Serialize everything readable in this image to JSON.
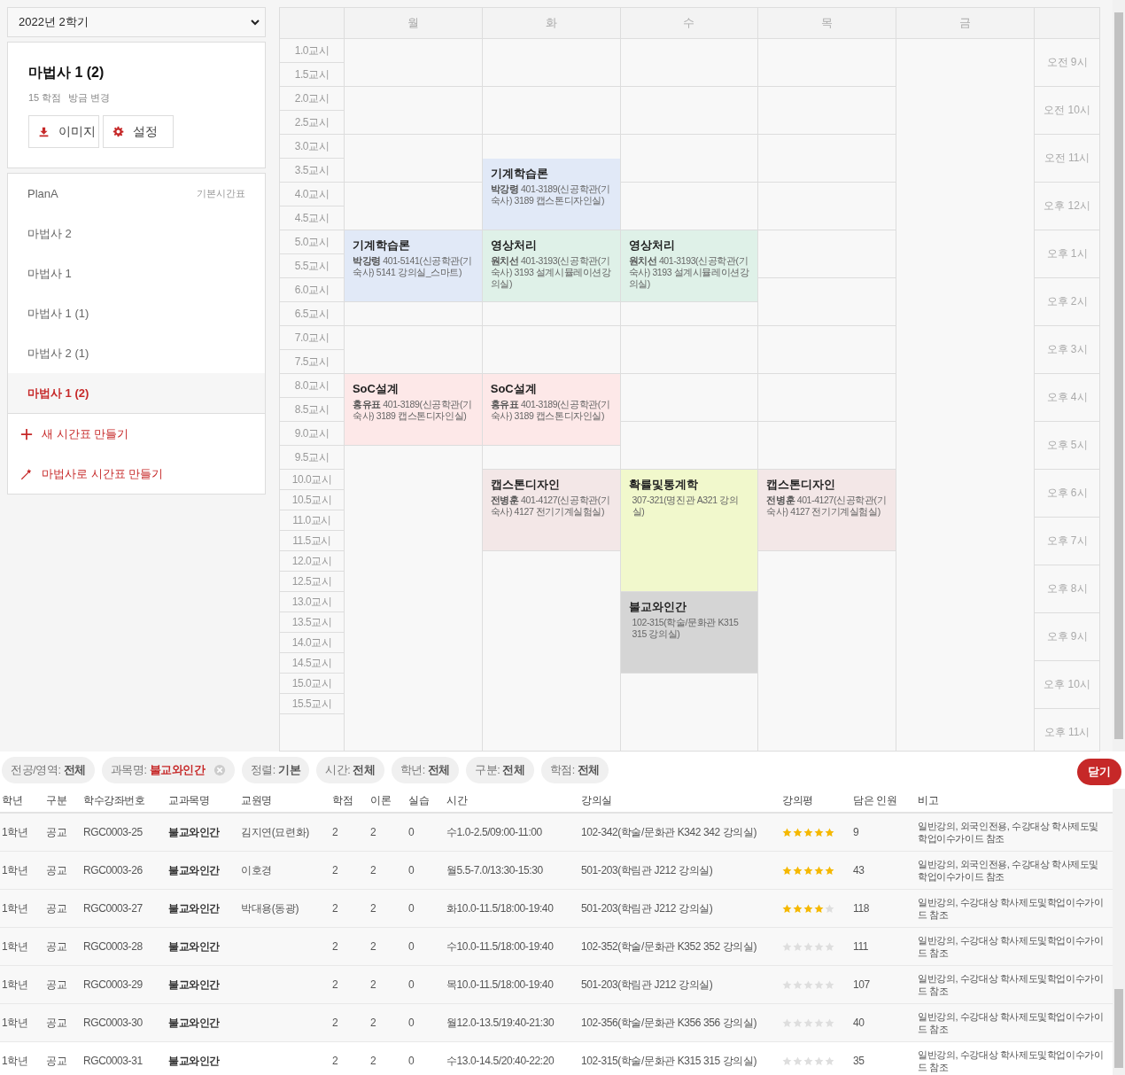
{
  "semester_select": {
    "value": "2022년 2학기"
  },
  "timetable_card": {
    "title": "마법사 1 (2)",
    "credits": "15 학점",
    "modified": "방금 변경",
    "buttons": [
      {
        "kind": "download",
        "label": "이미지"
      },
      {
        "kind": "settings",
        "label": "설정"
      }
    ]
  },
  "timetable_list": [
    {
      "label": "PlanA",
      "badge": "기본시간표",
      "selected": false
    },
    {
      "label": "마법사 2",
      "selected": false
    },
    {
      "label": "마법사 1",
      "selected": false
    },
    {
      "label": "마법사 1 (1)",
      "selected": false
    },
    {
      "label": "마법사 2 (1)",
      "selected": false
    },
    {
      "label": "마법사 1 (2)",
      "selected": true
    }
  ],
  "list_actions": [
    {
      "kind": "add",
      "label": "새 시간표 만들기"
    },
    {
      "kind": "wizard",
      "label": "마법사로 시간표 만들기"
    }
  ],
  "schedule": {
    "periods": [
      "1.0교시",
      "1.5교시",
      "2.0교시",
      "2.5교시",
      "3.0교시",
      "3.5교시",
      "4.0교시",
      "4.5교시",
      "5.0교시",
      "5.5교시",
      "6.0교시",
      "6.5교시",
      "7.0교시",
      "7.5교시",
      "8.0교시",
      "8.5교시",
      "9.0교시",
      "9.5교시",
      "10.0교시",
      "10.5교시",
      "11.0교시",
      "11.5교시",
      "12.0교시",
      "12.5교시",
      "13.0교시",
      "13.5교시",
      "14.0교시",
      "14.5교시",
      "15.0교시",
      "15.5교시"
    ],
    "days": [
      {
        "label": "월",
        "slots": [
          {
            "kind": "free"
          },
          {
            "kind": "free"
          },
          {
            "kind": "free"
          },
          {
            "kind": "free"
          },
          {
            "kind": "free"
          },
          {
            "kind": "free"
          },
          {
            "kind": "free"
          },
          {
            "kind": "free"
          },
          {
            "kind": "course",
            "title": "기계학습론",
            "professor": "박강령",
            "room": "401-5141(신공학관(기숙사) 5141 강의실_스마트)",
            "color": "#e1e9f7"
          },
          {
            "kind": "cont"
          },
          {
            "kind": "cont"
          },
          {
            "kind": "free"
          },
          {
            "kind": "free"
          },
          {
            "kind": "free"
          },
          {
            "kind": "course",
            "title": "SoC설계",
            "professor": "홍유표",
            "room": "401-3189(신공학관(기숙사) 3189 캡스톤디자인실)",
            "color": "#fde8e8"
          },
          {
            "kind": "cont"
          },
          {
            "kind": "cont"
          }
        ]
      },
      {
        "label": "화",
        "slots": [
          {
            "kind": "free"
          },
          {
            "kind": "free"
          },
          {
            "kind": "free"
          },
          {
            "kind": "free"
          },
          {
            "kind": "free"
          },
          {
            "kind": "course",
            "title": "기계학습론",
            "professor": "박강령",
            "room": "401-3189(신공학관(기숙사) 3189 캡스톤디자인실)",
            "color": "#e1e9f7"
          },
          {
            "kind": "cont"
          },
          {
            "kind": "cont"
          },
          {
            "kind": "course",
            "title": "영상처리",
            "professor": "원치선",
            "room": "401-3193(신공학관(기숙사) 3193 설계시뮬레이션강의실)",
            "color": "#dff1e8"
          },
          {
            "kind": "cont"
          },
          {
            "kind": "cont"
          },
          {
            "kind": "free"
          },
          {
            "kind": "free"
          },
          {
            "kind": "free"
          },
          {
            "kind": "course",
            "title": "SoC설계",
            "professor": "홍유표",
            "room": "401-3189(신공학관(기숙사) 3189 캡스톤디자인실)",
            "color": "#fde8e8"
          },
          {
            "kind": "cont"
          },
          {
            "kind": "cont"
          },
          {
            "kind": "free"
          },
          {
            "kind": "course",
            "title": "캡스톤디자인",
            "professor": "전병훈",
            "room": "401-4127(신공학관(기숙사) 4127 전기기계실험실)",
            "color": "#f3e7e7"
          },
          {
            "kind": "cont"
          },
          {
            "kind": "cont"
          },
          {
            "kind": "cont"
          }
        ]
      },
      {
        "label": "수",
        "slots": [
          {
            "kind": "free"
          },
          {
            "kind": "free"
          },
          {
            "kind": "free"
          },
          {
            "kind": "free"
          },
          {
            "kind": "free"
          },
          {
            "kind": "free"
          },
          {
            "kind": "free"
          },
          {
            "kind": "free"
          },
          {
            "kind": "course",
            "title": "영상처리",
            "professor": "원치선",
            "room": "401-3193(신공학관(기숙사) 3193 설계시뮬레이션강의실)",
            "color": "#dff1e8"
          },
          {
            "kind": "cont"
          },
          {
            "kind": "cont"
          },
          {
            "kind": "free"
          },
          {
            "kind": "free"
          },
          {
            "kind": "free"
          },
          {
            "kind": "free"
          },
          {
            "kind": "free"
          },
          {
            "kind": "free"
          },
          {
            "kind": "free"
          },
          {
            "kind": "course",
            "title": "확률및통계학",
            "room": "307-321(명진관 A321 강의실)",
            "color": "#f1f8cc"
          },
          {
            "kind": "cont"
          },
          {
            "kind": "cont"
          },
          {
            "kind": "cont"
          },
          {
            "kind": "cont"
          },
          {
            "kind": "cont"
          },
          {
            "kind": "course",
            "title": "불교와인간",
            "room": "102-315(학술/문화관 K315 315 강의실)",
            "color": "#d5d5d5"
          },
          {
            "kind": "cont"
          },
          {
            "kind": "cont"
          },
          {
            "kind": "cont"
          }
        ]
      },
      {
        "label": "목",
        "slots": [
          {
            "kind": "free"
          },
          {
            "kind": "free"
          },
          {
            "kind": "free"
          },
          {
            "kind": "free"
          },
          {
            "kind": "free"
          },
          {
            "kind": "free"
          },
          {
            "kind": "free"
          },
          {
            "kind": "free"
          },
          {
            "kind": "free"
          },
          {
            "kind": "free"
          },
          {
            "kind": "free"
          },
          {
            "kind": "free"
          },
          {
            "kind": "free"
          },
          {
            "kind": "free"
          },
          {
            "kind": "free"
          },
          {
            "kind": "free"
          },
          {
            "kind": "free"
          },
          {
            "kind": "free"
          },
          {
            "kind": "course",
            "title": "캡스톤디자인",
            "professor": "전병훈",
            "room": "401-4127(신공학관(기숙사) 4127 전기기계실험실)",
            "color": "#f3e7e7"
          },
          {
            "kind": "cont"
          },
          {
            "kind": "cont"
          },
          {
            "kind": "cont"
          }
        ]
      },
      {
        "label": "금"
      }
    ],
    "hours": [
      "오전 9시",
      "오전 10시",
      "오전 11시",
      "오후 12시",
      "오후 1시",
      "오후 2시",
      "오후 3시",
      "오후 4시",
      "오후 5시",
      "오후 6시",
      "오후 7시",
      "오후 8시",
      "오후 9시",
      "오후 10시",
      "오후 11시"
    ]
  },
  "filters": [
    {
      "label": "전공/영역:",
      "value": "전체",
      "highlighted": false,
      "removable": false
    },
    {
      "label": "과목명:",
      "value": "불교와인간",
      "highlighted": true,
      "removable": true
    },
    {
      "label": "정렬:",
      "value": "기본",
      "highlighted": false,
      "removable": false
    },
    {
      "label": "시간:",
      "value": "전체",
      "highlighted": false,
      "removable": false
    },
    {
      "label": "학년:",
      "value": "전체",
      "highlighted": false,
      "removable": false
    },
    {
      "label": "구분:",
      "value": "전체",
      "highlighted": false,
      "removable": false
    },
    {
      "label": "학점:",
      "value": "전체",
      "highlighted": false,
      "removable": false
    }
  ],
  "close_button": "닫기",
  "table": {
    "columns": [
      "학년",
      "구분",
      "학수강좌번호",
      "교과목명",
      "교원명",
      "학점",
      "이론",
      "실습",
      "시간",
      "강의실",
      "강의평",
      "담은 인원",
      "비고"
    ],
    "rows": [
      {
        "year": "1학년",
        "type": "공교",
        "code": "RGC0003-25",
        "name": "불교와인간",
        "instructor": "김지연(묘련화)",
        "credits": "2",
        "theory": "2",
        "practice": "0",
        "time": "수1.0-2.5/09:00-11:00",
        "room": "102-342(학술/문화관 K342 342 강의실)",
        "stars": 5,
        "count": "9",
        "note": "일반강의, 외국인전용, 수강대상 학사제도및학업이수가이드 참조"
      },
      {
        "year": "1학년",
        "type": "공교",
        "code": "RGC0003-26",
        "name": "불교와인간",
        "instructor": "이호경",
        "credits": "2",
        "theory": "2",
        "practice": "0",
        "time": "월5.5-7.0/13:30-15:30",
        "room": "501-203(학림관 J212 강의실)",
        "stars": 5,
        "count": "43",
        "note": "일반강의, 외국인전용, 수강대상 학사제도및학업이수가이드 참조"
      },
      {
        "year": "1학년",
        "type": "공교",
        "code": "RGC0003-27",
        "name": "불교와인간",
        "instructor": "박대용(동광)",
        "credits": "2",
        "theory": "2",
        "practice": "0",
        "time": "화10.0-11.5/18:00-19:40",
        "room": "501-203(학림관 J212 강의실)",
        "stars": 4,
        "count": "118",
        "note": "일반강의, 수강대상 학사제도및학업이수가이드 참조"
      },
      {
        "year": "1학년",
        "type": "공교",
        "code": "RGC0003-28",
        "name": "불교와인간",
        "credits": "2",
        "theory": "2",
        "practice": "0",
        "time": "수10.0-11.5/18:00-19:40",
        "room": "102-352(학술/문화관 K352 352 강의실)",
        "stars": 0,
        "count": "111",
        "note": "일반강의, 수강대상 학사제도및학업이수가이드 참조"
      },
      {
        "year": "1학년",
        "type": "공교",
        "code": "RGC0003-29",
        "name": "불교와인간",
        "credits": "2",
        "theory": "2",
        "practice": "0",
        "time": "목10.0-11.5/18:00-19:40",
        "room": "501-203(학림관 J212 강의실)",
        "stars": 0,
        "count": "107",
        "note": "일반강의, 수강대상 학사제도및학업이수가이드 참조"
      },
      {
        "year": "1학년",
        "type": "공교",
        "code": "RGC0003-30",
        "name": "불교와인간",
        "credits": "2",
        "theory": "2",
        "practice": "0",
        "time": "월12.0-13.5/19:40-21:30",
        "room": "102-356(학술/문화관 K356 356 강의실)",
        "stars": 0,
        "count": "40",
        "note": "일반강의, 수강대상 학사제도및학업이수가이드 참조"
      },
      {
        "year": "1학년",
        "type": "공교",
        "code": "RGC0003-31",
        "name": "불교와인간",
        "credits": "2",
        "theory": "2",
        "practice": "0",
        "time": "수13.0-14.5/20:40-22:20",
        "room": "102-315(학술/문화관 K315 315 강의실)",
        "stars": 0,
        "count": "35",
        "note": "일반강의, 수강대상 학사제도및학업이수가이드 참조"
      }
    ]
  }
}
